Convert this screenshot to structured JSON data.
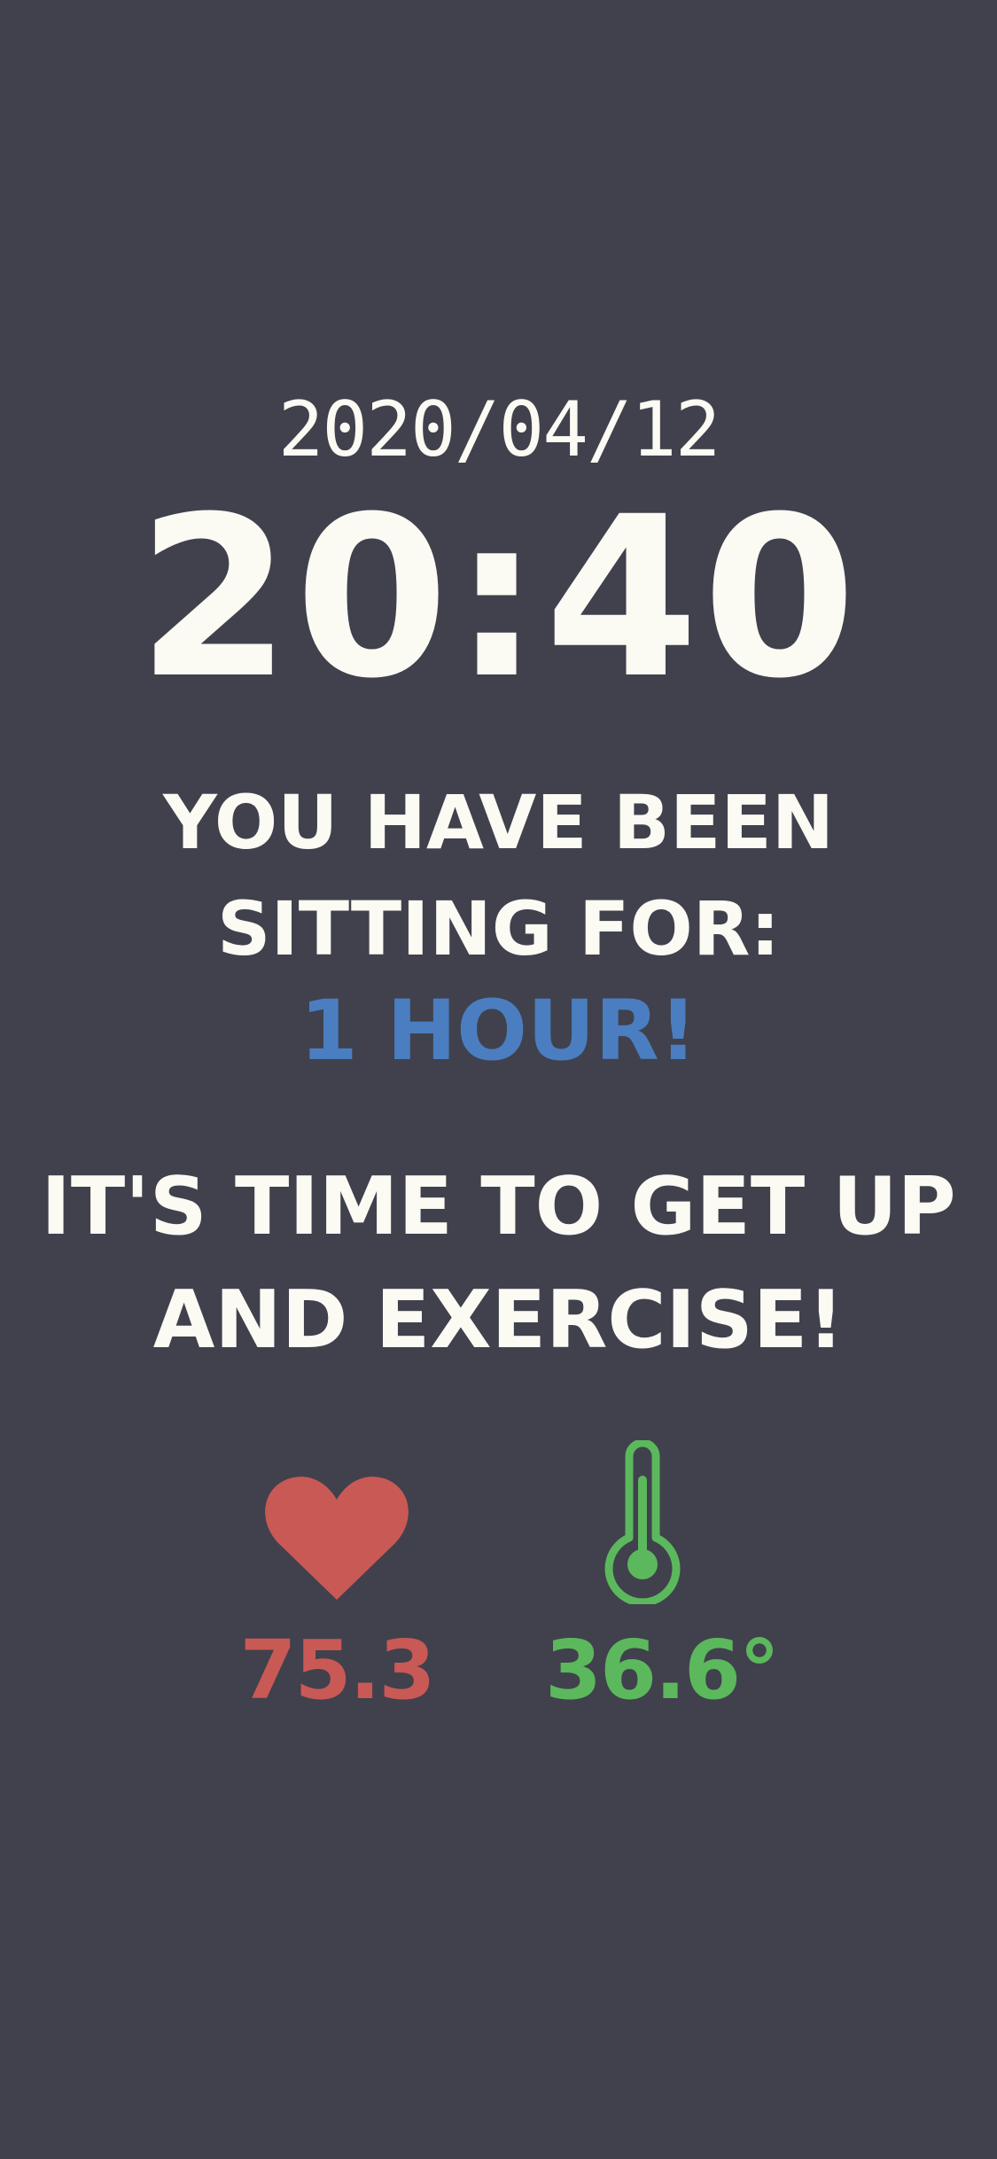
{
  "screen": {
    "date": "2020/04/12",
    "time": "20:40",
    "sitting_line1": "YOU HAVE BEEN",
    "sitting_line2": "SITTING FOR:",
    "duration": "1 HOUR!",
    "exercise_line1": "IT'S TIME TO GET UP",
    "exercise_line2": "AND EXERCISE!"
  },
  "metrics": {
    "heart_rate": {
      "icon": "heart-icon",
      "value": "75.3",
      "color": "#c95955"
    },
    "temperature": {
      "icon": "thermometer-icon",
      "value": "36.6°",
      "color": "#5cb85c"
    }
  },
  "colors": {
    "background": "#40414d",
    "text": "#fbfaf3",
    "accent": "#4a7ec0"
  }
}
